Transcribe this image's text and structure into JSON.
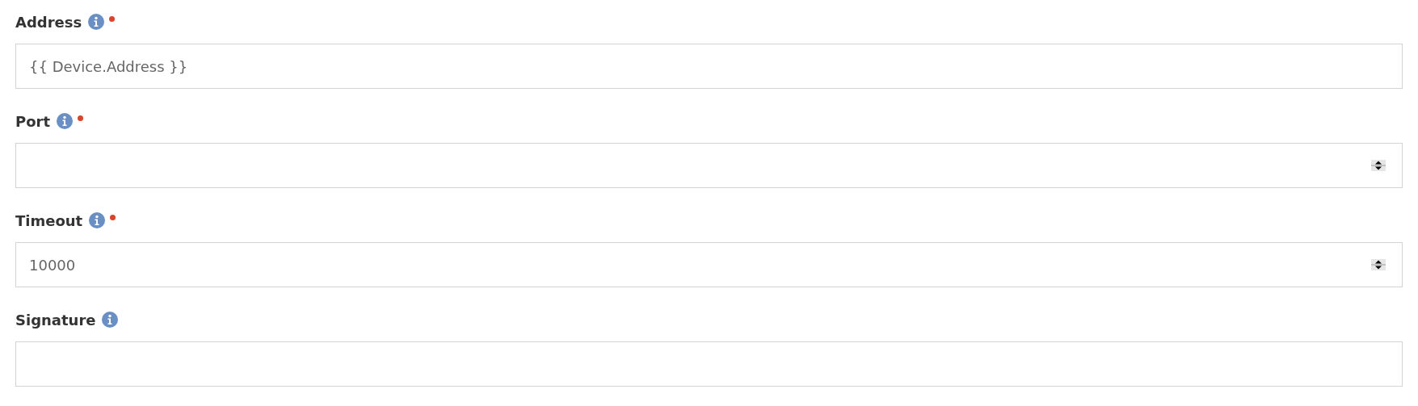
{
  "fields": [
    {
      "label": "Address",
      "required": true,
      "kind": "text",
      "value": "{{ Device.Address }}"
    },
    {
      "label": "Port",
      "required": true,
      "kind": "number"
    },
    {
      "label": "Timeout",
      "required": true,
      "kind": "number",
      "value": "10000"
    },
    {
      "label": "Signature",
      "required": false,
      "kind": "text"
    }
  ]
}
